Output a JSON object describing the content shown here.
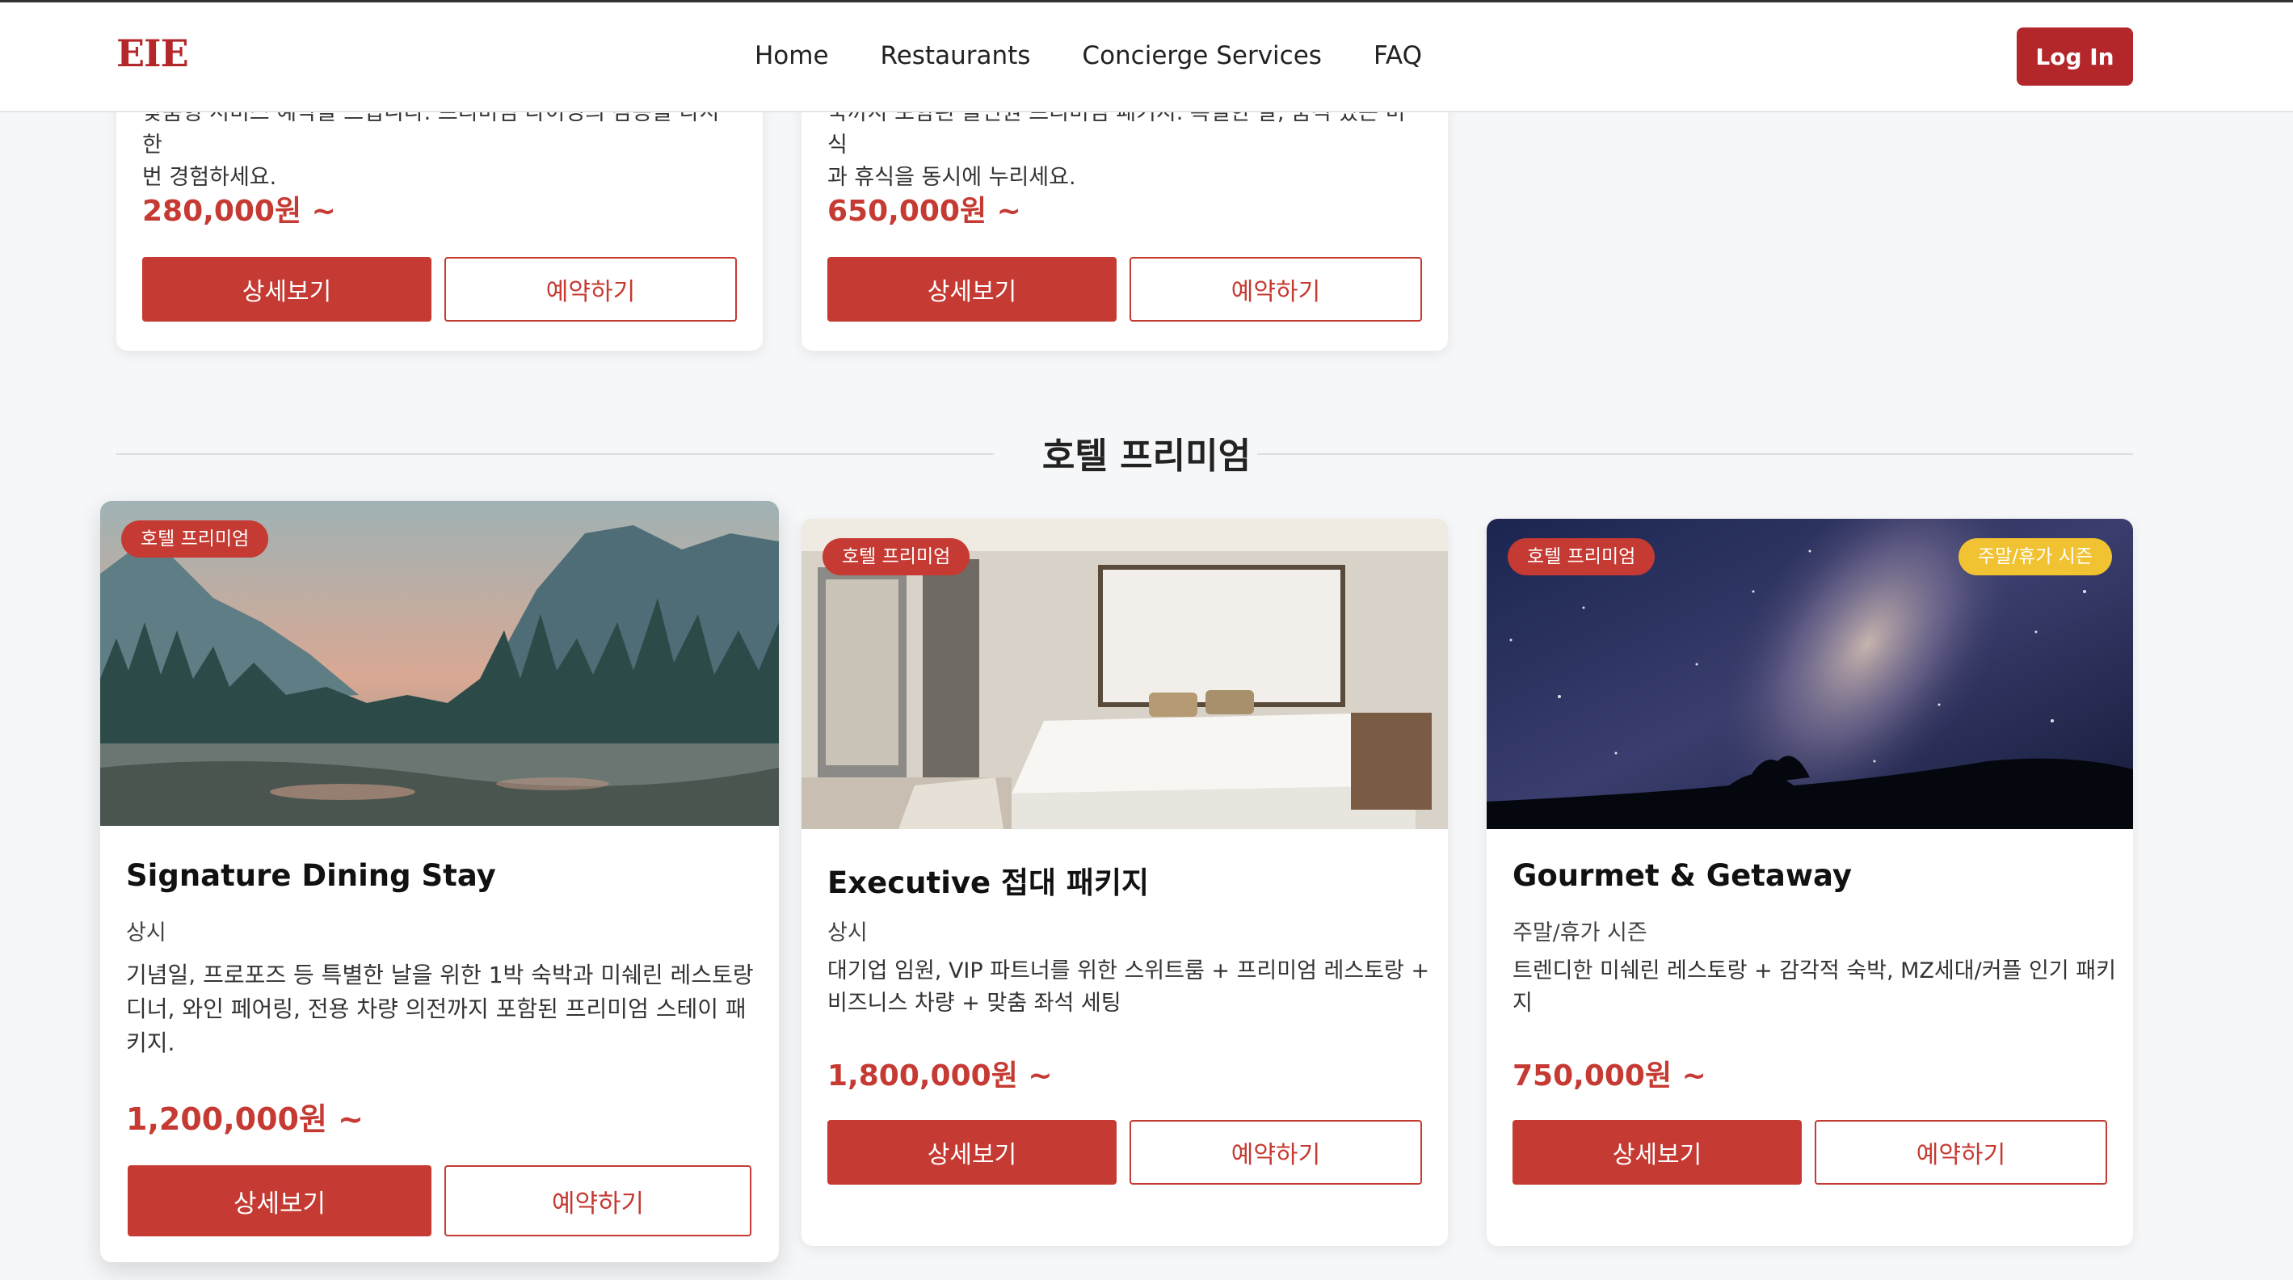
{
  "header": {
    "logo": "EIE",
    "nav": [
      "Home",
      "Restaurants",
      "Concierge Services",
      "FAQ"
    ],
    "login_label": "Log In"
  },
  "top_cards": [
    {
      "desc_cut": "맞춤형 서비스 예약을 드립니다. 프리미엄 다이닝의 감동을 다시 한",
      "desc_last": "번 경험하세요.",
      "price": "280,000원 ~",
      "detail_label": "상세보기",
      "reserve_label": "예약하기"
    },
    {
      "desc_cut": "숙까지 포함된 올인원 프리미엄 패키지. 특별한 날, 품격 있는 미식",
      "desc_last": "과 휴식을 동시에 누리세요.",
      "price": "650,000원 ~",
      "detail_label": "상세보기",
      "reserve_label": "예약하기"
    }
  ],
  "section": {
    "title": "호텔 프리미엄"
  },
  "cards": [
    {
      "badge": "호텔 프리미엄",
      "title": "Signature Dining Stay",
      "period": "상시",
      "desc_lines": [
        "기념일, 프로포즈 등 특별한 날을 위한 1박 숙박과 미쉐린 레스토랑",
        "디너, 와인 페어링, 전용 차량 의전까지 포함된 프리미엄 스테이 패",
        "키지."
      ],
      "price": "1,200,000원 ~",
      "detail_label": "상세보기",
      "reserve_label": "예약하기",
      "image_icon": "mountain-forest-image"
    },
    {
      "badge": "호텔 프리미엄",
      "title": "Executive 접대 패키지",
      "period": "상시",
      "desc_lines": [
        "대기업 임원, VIP 파트너를 위한 스위트룸 + 프리미엄 레스토랑 +",
        "비즈니스 차량 + 맞춤 좌석 세팅"
      ],
      "price": "1,800,000원 ~",
      "detail_label": "상세보기",
      "reserve_label": "예약하기",
      "image_icon": "hotel-bedroom-image"
    },
    {
      "badge": "호텔 프리미엄",
      "badge2": "주말/휴가 시즌",
      "title": "Gourmet & Getaway",
      "period": "주말/휴가 시즌",
      "desc_lines": [
        "트렌디한 미쉐린 레스토랑 + 감각적 숙박, MZ세대/커플 인기 패키",
        "지"
      ],
      "price": "750,000원 ~",
      "detail_label": "상세보기",
      "reserve_label": "예약하기",
      "image_icon": "night-sky-image"
    }
  ],
  "colors": {
    "brand": "#b3262a",
    "accent": "#c53a32",
    "season_badge": "#f1c232"
  }
}
